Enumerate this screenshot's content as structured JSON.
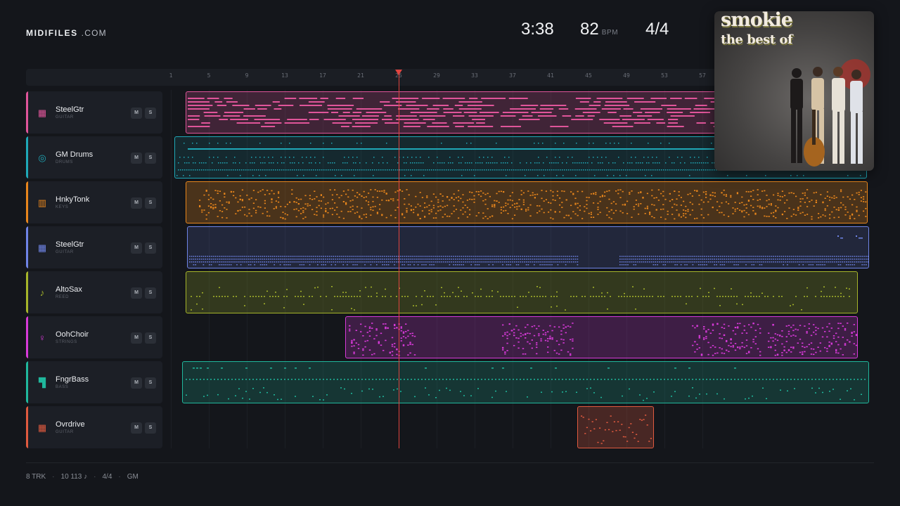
{
  "brand": {
    "bold": "MIDIFILES",
    "light": ".COM"
  },
  "transport": {
    "time": "3:38",
    "bpm": "82",
    "bpm_unit": "BPM",
    "signature": "4/4"
  },
  "ruler": {
    "bars": [
      "1",
      "5",
      "9",
      "13",
      "17",
      "21",
      "25",
      "29",
      "33",
      "37",
      "41",
      "45",
      "49",
      "53",
      "57"
    ]
  },
  "playhead_bar": 25,
  "tracks": [
    {
      "name": "SteelGtr",
      "type": "GUITAR",
      "icon": "guitar-grid-icon",
      "color": "#e0559a",
      "mute": "M",
      "solo": "S"
    },
    {
      "name": "GM Drums",
      "type": "DRUMS",
      "icon": "drum-icon",
      "color": "#1fa9b8",
      "mute": "M",
      "solo": "S"
    },
    {
      "name": "HnkyTonk",
      "type": "KEYS",
      "icon": "piano-keys-icon",
      "color": "#e8861c",
      "mute": "M",
      "solo": "S"
    },
    {
      "name": "SteelGtr",
      "type": "GUITAR",
      "icon": "guitar-grid-icon",
      "color": "#6f84e6",
      "mute": "M",
      "solo": "S"
    },
    {
      "name": "AltoSax",
      "type": "REED",
      "icon": "saxophone-icon",
      "color": "#a6b52a",
      "mute": "M",
      "solo": "S"
    },
    {
      "name": "OohChoir",
      "type": "STRINGS",
      "icon": "choir-icon",
      "color": "#d83ad9",
      "mute": "M",
      "solo": "S"
    },
    {
      "name": "FngrBass",
      "type": "BASS",
      "icon": "bass-icon",
      "color": "#20b89d",
      "mute": "M",
      "solo": "S"
    },
    {
      "name": "Ovrdrive",
      "type": "GUITAR",
      "icon": "guitar-grid-icon",
      "color": "#e05a3f",
      "mute": "M",
      "solo": "S"
    }
  ],
  "album": {
    "title": "smokie",
    "subtitle": "the best of"
  },
  "footer": {
    "tracks": "8 TRK",
    "notes": "10 113 ♪",
    "signature": "4/4",
    "standard": "GM"
  }
}
